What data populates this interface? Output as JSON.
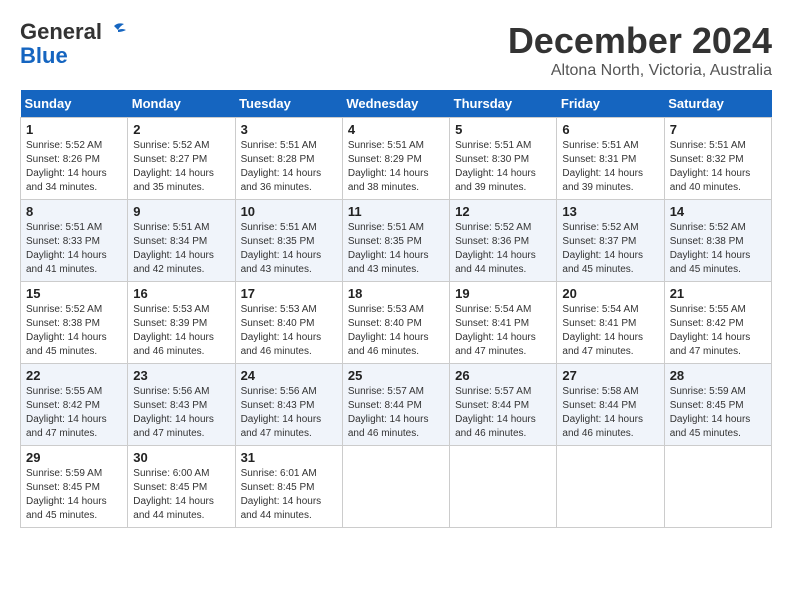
{
  "header": {
    "logo_line1": "General",
    "logo_line2": "Blue",
    "month": "December 2024",
    "location": "Altona North, Victoria, Australia"
  },
  "days_of_week": [
    "Sunday",
    "Monday",
    "Tuesday",
    "Wednesday",
    "Thursday",
    "Friday",
    "Saturday"
  ],
  "weeks": [
    [
      {
        "day": "1",
        "sunrise": "5:52 AM",
        "sunset": "8:26 PM",
        "daylight": "14 hours and 34 minutes."
      },
      {
        "day": "2",
        "sunrise": "5:52 AM",
        "sunset": "8:27 PM",
        "daylight": "14 hours and 35 minutes."
      },
      {
        "day": "3",
        "sunrise": "5:51 AM",
        "sunset": "8:28 PM",
        "daylight": "14 hours and 36 minutes."
      },
      {
        "day": "4",
        "sunrise": "5:51 AM",
        "sunset": "8:29 PM",
        "daylight": "14 hours and 38 minutes."
      },
      {
        "day": "5",
        "sunrise": "5:51 AM",
        "sunset": "8:30 PM",
        "daylight": "14 hours and 39 minutes."
      },
      {
        "day": "6",
        "sunrise": "5:51 AM",
        "sunset": "8:31 PM",
        "daylight": "14 hours and 39 minutes."
      },
      {
        "day": "7",
        "sunrise": "5:51 AM",
        "sunset": "8:32 PM",
        "daylight": "14 hours and 40 minutes."
      }
    ],
    [
      {
        "day": "8",
        "sunrise": "5:51 AM",
        "sunset": "8:33 PM",
        "daylight": "14 hours and 41 minutes."
      },
      {
        "day": "9",
        "sunrise": "5:51 AM",
        "sunset": "8:34 PM",
        "daylight": "14 hours and 42 minutes."
      },
      {
        "day": "10",
        "sunrise": "5:51 AM",
        "sunset": "8:35 PM",
        "daylight": "14 hours and 43 minutes."
      },
      {
        "day": "11",
        "sunrise": "5:51 AM",
        "sunset": "8:35 PM",
        "daylight": "14 hours and 43 minutes."
      },
      {
        "day": "12",
        "sunrise": "5:52 AM",
        "sunset": "8:36 PM",
        "daylight": "14 hours and 44 minutes."
      },
      {
        "day": "13",
        "sunrise": "5:52 AM",
        "sunset": "8:37 PM",
        "daylight": "14 hours and 45 minutes."
      },
      {
        "day": "14",
        "sunrise": "5:52 AM",
        "sunset": "8:38 PM",
        "daylight": "14 hours and 45 minutes."
      }
    ],
    [
      {
        "day": "15",
        "sunrise": "5:52 AM",
        "sunset": "8:38 PM",
        "daylight": "14 hours and 45 minutes."
      },
      {
        "day": "16",
        "sunrise": "5:53 AM",
        "sunset": "8:39 PM",
        "daylight": "14 hours and 46 minutes."
      },
      {
        "day": "17",
        "sunrise": "5:53 AM",
        "sunset": "8:40 PM",
        "daylight": "14 hours and 46 minutes."
      },
      {
        "day": "18",
        "sunrise": "5:53 AM",
        "sunset": "8:40 PM",
        "daylight": "14 hours and 46 minutes."
      },
      {
        "day": "19",
        "sunrise": "5:54 AM",
        "sunset": "8:41 PM",
        "daylight": "14 hours and 47 minutes."
      },
      {
        "day": "20",
        "sunrise": "5:54 AM",
        "sunset": "8:41 PM",
        "daylight": "14 hours and 47 minutes."
      },
      {
        "day": "21",
        "sunrise": "5:55 AM",
        "sunset": "8:42 PM",
        "daylight": "14 hours and 47 minutes."
      }
    ],
    [
      {
        "day": "22",
        "sunrise": "5:55 AM",
        "sunset": "8:42 PM",
        "daylight": "14 hours and 47 minutes."
      },
      {
        "day": "23",
        "sunrise": "5:56 AM",
        "sunset": "8:43 PM",
        "daylight": "14 hours and 47 minutes."
      },
      {
        "day": "24",
        "sunrise": "5:56 AM",
        "sunset": "8:43 PM",
        "daylight": "14 hours and 47 minutes."
      },
      {
        "day": "25",
        "sunrise": "5:57 AM",
        "sunset": "8:44 PM",
        "daylight": "14 hours and 46 minutes."
      },
      {
        "day": "26",
        "sunrise": "5:57 AM",
        "sunset": "8:44 PM",
        "daylight": "14 hours and 46 minutes."
      },
      {
        "day": "27",
        "sunrise": "5:58 AM",
        "sunset": "8:44 PM",
        "daylight": "14 hours and 46 minutes."
      },
      {
        "day": "28",
        "sunrise": "5:59 AM",
        "sunset": "8:45 PM",
        "daylight": "14 hours and 45 minutes."
      }
    ],
    [
      {
        "day": "29",
        "sunrise": "5:59 AM",
        "sunset": "8:45 PM",
        "daylight": "14 hours and 45 minutes."
      },
      {
        "day": "30",
        "sunrise": "6:00 AM",
        "sunset": "8:45 PM",
        "daylight": "14 hours and 44 minutes."
      },
      {
        "day": "31",
        "sunrise": "6:01 AM",
        "sunset": "8:45 PM",
        "daylight": "14 hours and 44 minutes."
      },
      null,
      null,
      null,
      null
    ]
  ]
}
